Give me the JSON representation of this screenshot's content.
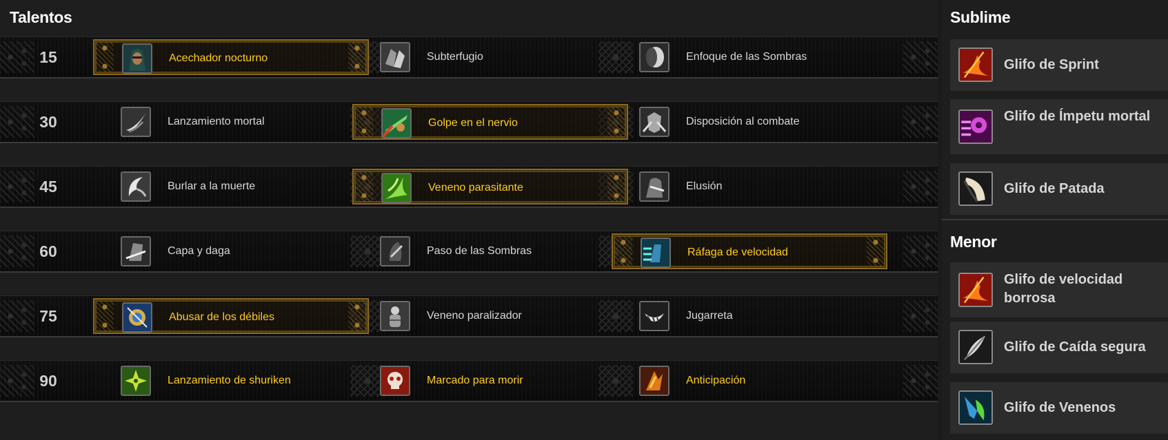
{
  "talents": {
    "title": "Talentos",
    "tiers": [
      {
        "level": "15",
        "options": [
          {
            "name": "Acechador nocturno",
            "icon": "hooded-rogue-icon",
            "selected": true
          },
          {
            "name": "Subterfugio",
            "icon": "hands-icon",
            "selected": false
          },
          {
            "name": "Enfoque de las Sombras",
            "icon": "shadow-face-icon",
            "selected": false
          }
        ]
      },
      {
        "level": "30",
        "options": [
          {
            "name": "Lanzamiento mortal",
            "icon": "throw-icon",
            "selected": false
          },
          {
            "name": "Golpe en el nervio",
            "icon": "nerve-strike-icon",
            "selected": true
          },
          {
            "name": "Disposición al combate",
            "icon": "combat-readiness-icon",
            "selected": false
          }
        ]
      },
      {
        "level": "45",
        "options": [
          {
            "name": "Burlar a la muerte",
            "icon": "cheat-death-icon",
            "selected": false
          },
          {
            "name": "Veneno parasitante",
            "icon": "leeching-poison-icon",
            "selected": true
          },
          {
            "name": "Elusión",
            "icon": "elusiveness-icon",
            "selected": false
          }
        ]
      },
      {
        "level": "60",
        "options": [
          {
            "name": "Capa y daga",
            "icon": "cloak-dagger-icon",
            "selected": false
          },
          {
            "name": "Paso de las Sombras",
            "icon": "shadowstep-icon",
            "selected": false
          },
          {
            "name": "Ráfaga de velocidad",
            "icon": "burst-of-speed-icon",
            "selected": true
          }
        ]
      },
      {
        "level": "75",
        "options": [
          {
            "name": "Abusar de los débiles",
            "icon": "prey-on-weak-icon",
            "selected": true
          },
          {
            "name": "Veneno paralizador",
            "icon": "paralytic-poison-icon",
            "selected": false
          },
          {
            "name": "Jugarreta",
            "icon": "dirty-tricks-icon",
            "selected": false
          }
        ]
      },
      {
        "level": "90",
        "options": [
          {
            "name": "Lanzamiento de shuriken",
            "icon": "shuriken-icon",
            "selected": false,
            "gold": true
          },
          {
            "name": "Marcado para morir",
            "icon": "marked-skull-icon",
            "selected": false,
            "gold": true
          },
          {
            "name": "Anticipación",
            "icon": "anticipation-icon",
            "selected": false,
            "gold": true
          }
        ]
      }
    ]
  },
  "glyphs": {
    "major_title": "Sublime",
    "major": [
      {
        "name": "Glifo de Sprint",
        "icon": "sprint-icon"
      },
      {
        "name": "Glifo de Ímpetu mortal",
        "icon": "deadly-momentum-icon"
      },
      {
        "name": "Glifo de Patada",
        "icon": "kick-icon"
      }
    ],
    "minor_title": "Menor",
    "minor": [
      {
        "name": "Glifo de velocidad borrosa",
        "icon": "blurred-speed-icon"
      },
      {
        "name": "Glifo de Caída segura",
        "icon": "feather-icon"
      },
      {
        "name": "Glifo de Venenos",
        "icon": "poisons-icon"
      }
    ]
  },
  "colors": {
    "selected_text": "#ffcc22",
    "normal_text": "#d8d8d8",
    "frame_gold": "#8a6a22"
  }
}
